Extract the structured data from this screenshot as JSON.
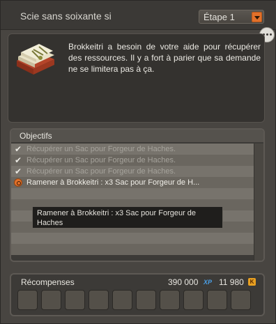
{
  "title": "Scie sans soixante si",
  "stage": {
    "selected": "Étape 1"
  },
  "more_button": "more-options",
  "description": "Brokkeitri a besoin de votre aide pour récupérer des ressources. Il y a fort à parier que sa demande ne se limitera pas à ça.",
  "objectives": {
    "header": "Objectifs",
    "items": [
      {
        "text": "Récupérer un Sac pour Forgeur de Haches.",
        "status": "done",
        "icon": "checkmark-icon"
      },
      {
        "text": "Récupérer un Sac pour Forgeur de Haches.",
        "status": "done",
        "icon": "checkmark-icon"
      },
      {
        "text": "Récupérer un Sac pour Forgeur de Haches.",
        "status": "done",
        "icon": "checkmark-icon"
      },
      {
        "text": "Ramener à Brokkeitri : x3 Sac pour Forgeur de H...",
        "status": "active",
        "icon": "active-objective-icon"
      }
    ],
    "tooltip": "Ramener à Brokkeitri : x3 Sac pour Forgeur de Haches"
  },
  "rewards": {
    "title": "Récompenses",
    "xp": "390 000",
    "xp_icon_label": "XP",
    "kamas": "11 980",
    "kamas_icon_label": "K",
    "slot_count": 10
  },
  "colors": {
    "accent": "#e2712a",
    "xp_icon": "#4a9fe6",
    "kamas_icon": "#e8a021"
  }
}
